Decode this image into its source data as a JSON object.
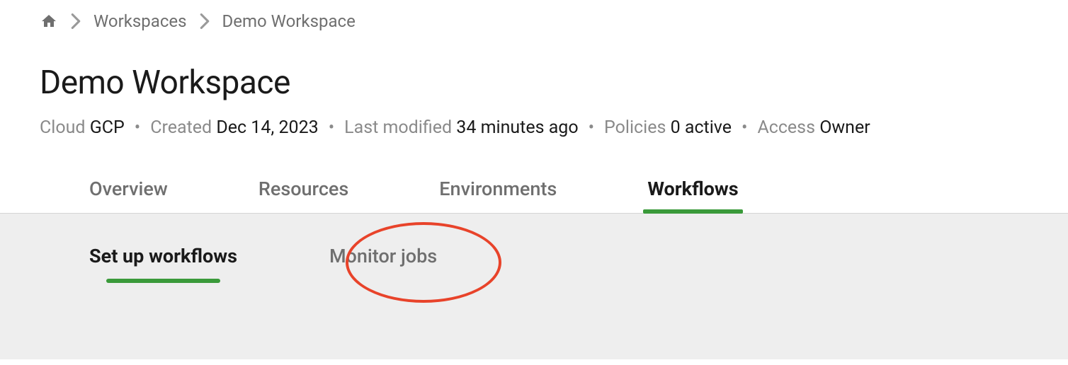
{
  "breadcrumb": {
    "items": [
      "Workspaces",
      "Demo Workspace"
    ]
  },
  "page": {
    "title": "Demo Workspace"
  },
  "meta": {
    "cloud_label": "Cloud",
    "cloud_value": "GCP",
    "created_label": "Created",
    "created_value": "Dec 14, 2023",
    "modified_label": "Last modified",
    "modified_value": "34 minutes ago",
    "policies_label": "Policies",
    "policies_value": "0 active",
    "access_label": "Access",
    "access_value": "Owner"
  },
  "tabs": {
    "overview": "Overview",
    "resources": "Resources",
    "environments": "Environments",
    "workflows": "Workflows"
  },
  "subtabs": {
    "setup": "Set up workflows",
    "monitor": "Monitor jobs"
  }
}
